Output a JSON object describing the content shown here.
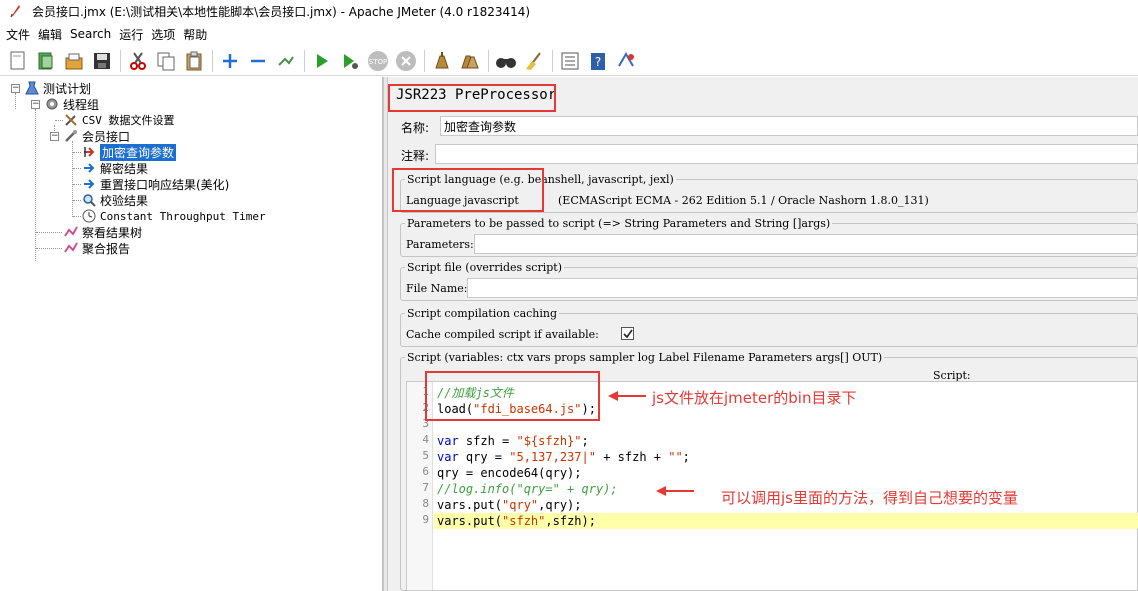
{
  "window": {
    "title": "会员接口.jmx (E:\\测试相关\\本地性能脚本\\会员接口.jmx) - Apache JMeter (4.0 r1823414)"
  },
  "menu": [
    "文件",
    "编辑",
    "Search",
    "运行",
    "选项",
    "帮助"
  ],
  "toolbar": {
    "icons": [
      "new-icon",
      "templates-icon",
      "open-icon",
      "save-icon",
      "cut-icon",
      "copy-icon",
      "paste-icon",
      "expand-icon",
      "collapse-icon",
      "toggle-icon",
      "start-icon",
      "start-no-pause-icon",
      "stop-icon",
      "shutdown-icon",
      "clear-icon",
      "clear-all-icon",
      "search-icon",
      "reset-search-icon",
      "function-helper-icon",
      "help-icon",
      "remote-icon"
    ]
  },
  "tree": {
    "test_plan": "测试计划",
    "thread_group": "线程组",
    "csv": "CSV 数据文件设置",
    "sampler": "会员接口",
    "preprocessor": "加密查询参数",
    "post1": "解密结果",
    "post2": "重置接口响应结果(美化)",
    "assertion": "校验结果",
    "timer": "Constant Throughput Timer",
    "listener1": "察看结果树",
    "listener2": "聚合报告"
  },
  "panel": {
    "title": "JSR223 PreProcessor",
    "name_label": "名称:",
    "name_value": "加密查询参数",
    "comment_label": "注释:",
    "comment_value": "",
    "lang_group": "Script language (e.g. beanshell, javascript, jexl)",
    "lang_label": "Language:",
    "lang_value": "javascript",
    "lang_desc": "(ECMAScript ECMA - 262 Edition 5.1 / Oracle Nashorn 1.8.0_131)",
    "params_group": "Parameters to be passed to script (=> String Parameters and String []args)",
    "params_label": "Parameters:",
    "params_value": "",
    "file_group": "Script file (overrides script)",
    "file_label": "File Name:",
    "file_value": "",
    "cache_group": "Script compilation caching",
    "cache_label": "Cache compiled script if available:",
    "cache_checked": true,
    "script_group": "Script (variables: ctx vars props sampler log Label Filename Parameters args[] OUT)",
    "script_label": "Script:"
  },
  "code_lines": [
    "//加载js文件",
    "load(\"fdi_base64.js\");",
    "",
    "var sfzh = \"${sfzh}\";",
    "var qry = \"5,137,237|\" + sfzh + \"\";",
    "qry = encode64(qry);",
    "//log.info(\"qry=\" + qry);",
    "vars.put(\"qry\",qry);",
    "vars.put(\"sfzh\",sfzh);"
  ],
  "annotations": {
    "note1": "js文件放在jmeter的bin目录下",
    "note2": "可以调用js里面的方法，得到自己想要的变量"
  },
  "colors": {
    "annotation_red": "#e53935",
    "selection_blue": "#1d6ed1",
    "highlight_line": "#ffffaa"
  }
}
